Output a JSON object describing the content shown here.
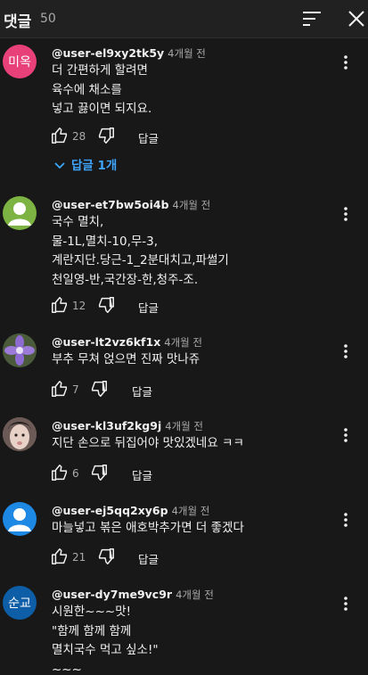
{
  "header": {
    "title": "댓글",
    "count": "50"
  },
  "comments": [
    {
      "avatar_text": "미옥",
      "avatar_color": "#e8417a",
      "author": "@user-el9xy2tk5y",
      "time": "4개월 전",
      "lines": [
        "더 간편하게 할려면",
        "육수에 채소를",
        "넣고 끓이면 되지요."
      ],
      "likes": "28",
      "reply_label": "답글",
      "replies_label": "답글 1개"
    },
    {
      "avatar_text": "",
      "avatar_icon": "default-person-icon",
      "avatar_color": "#7cb342",
      "author": "@user-et7bw5oi4b",
      "time": "4개월 전",
      "lines": [
        "국수 멸치,",
        "물-1L,멸치-10,무-3,",
        "계란지단.당근-1_2분대치고,파썰기",
        "천일영-반,국간장-한,청주-조."
      ],
      "likes": "12",
      "reply_label": "답글"
    },
    {
      "avatar_text": "",
      "avatar_icon": "purple-flower-photo",
      "avatar_color": "#4a5a3a",
      "author": "@user-lt2vz6kf1x",
      "time": "4개월 전",
      "lines": [
        "부추 무쳐 얹으면 진짜 맛나쥬"
      ],
      "likes": "7",
      "reply_label": "답글"
    },
    {
      "avatar_text": "",
      "avatar_icon": "face-photo",
      "avatar_color": "#8a6f66",
      "author": "@user-kl3uf2kg9j",
      "time": "4개월 전",
      "lines": [
        "지단 손으로 뒤집어야 맛있겠네요 ㅋㅋ"
      ],
      "likes": "6",
      "reply_label": "답글"
    },
    {
      "avatar_text": "",
      "avatar_icon": "default-person-icon",
      "avatar_color": "#1e88e5",
      "author": "@user-ej5qq2xy6p",
      "time": "4개월 전",
      "lines": [
        "마늘넣고 볶은 애호박추가면 더 좋겠다"
      ],
      "likes": "21",
      "reply_label": "답글"
    },
    {
      "avatar_text": "순교",
      "avatar_color": "#0d5ea6",
      "author": "@user-dy7me9vc9r",
      "time": "4개월 전",
      "lines": [
        "시원한~~~맛!",
        "\"함께 함께 함께",
        "멸치국수 먹고 싶소!\"",
        "~~~"
      ]
    }
  ]
}
